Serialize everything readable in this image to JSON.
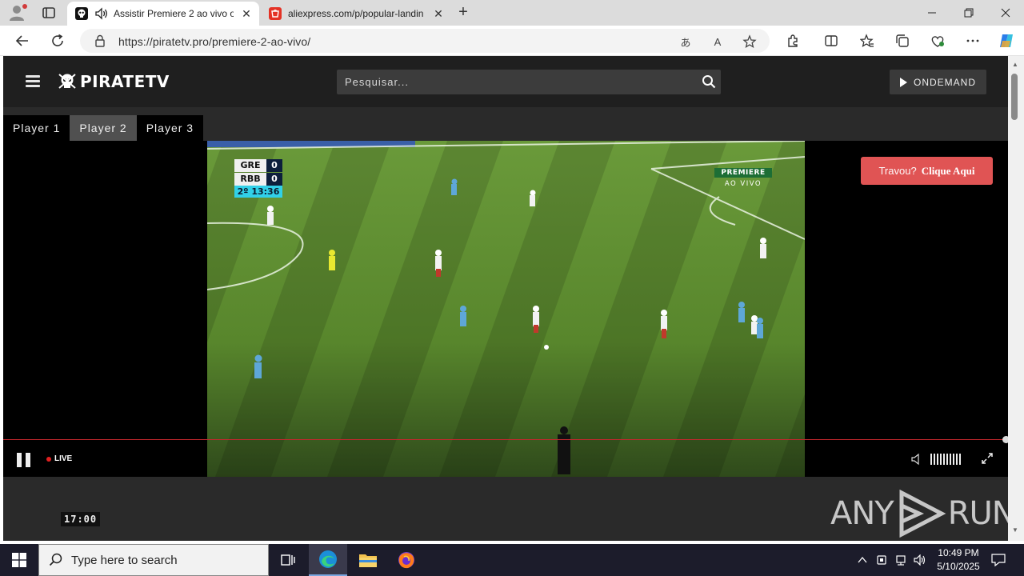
{
  "browser": {
    "tabs": [
      {
        "title": "Assistir Premiere 2 ao vivo o",
        "active": true,
        "audio": true
      },
      {
        "title": "aliexpress.com/p/popular-landin",
        "active": false
      }
    ],
    "url": "https://piratetv.pro/premiere-2-ao-vivo/"
  },
  "site": {
    "logo_text": "PIRATETV",
    "search_placeholder": "Pesquisar...",
    "ondemand_label": "ONDEMAND",
    "player_tabs": [
      {
        "label": "Player 1",
        "active": false
      },
      {
        "label": "Player 2",
        "active": true
      },
      {
        "label": "Player 3",
        "active": false
      }
    ]
  },
  "video": {
    "scoreboard": {
      "teams": [
        {
          "name": "GRE",
          "score": "0"
        },
        {
          "name": "RBB",
          "score": "0"
        }
      ],
      "clock": "2º 13:36"
    },
    "broadcaster": {
      "name": "PREMIERE",
      "subtitle": "AO VIVO"
    },
    "travou": {
      "question": "Travou?",
      "action": "Clique Aqui"
    },
    "live_label": "LIVE"
  },
  "page_time": "17:00",
  "watermark": {
    "left": "ANY",
    "right": "RUN"
  },
  "taskbar": {
    "search_placeholder": "Type here to search",
    "time": "10:49 PM",
    "date": "5/10/2025"
  },
  "colors": {
    "accent_red": "#e05454",
    "progress_red": "#c1272d",
    "pitch_green": "#5b8a2e"
  }
}
